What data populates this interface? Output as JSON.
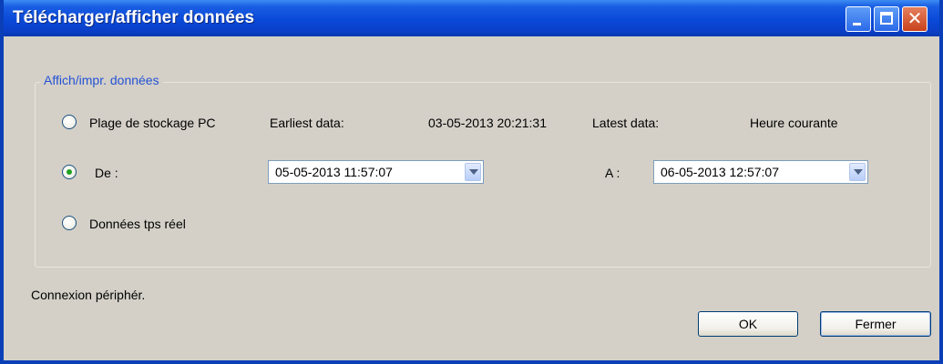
{
  "window": {
    "title": "Télécharger/afficher données"
  },
  "titlebar_buttons": {
    "minimize_icon": "minimize-icon",
    "maximize_icon": "maximize-icon",
    "close_icon": "close-icon",
    "close_glyph": "✕"
  },
  "group": {
    "legend": "Affich/impr. données"
  },
  "options": {
    "storage_range": {
      "label": "Plage de stockage PC",
      "selected": false
    },
    "from": {
      "label": "De :",
      "selected": true
    },
    "realtime": {
      "label": "Données tps réel",
      "selected": false
    }
  },
  "storage_info": {
    "earliest_label": "Earliest data:",
    "earliest_value": "03-05-2013 20:21:31",
    "latest_label": "Latest data:",
    "latest_value": "Heure courante"
  },
  "from_combo": {
    "value": "05-05-2013 11:57:07"
  },
  "to": {
    "label": "A :",
    "value": "06-05-2013 12:57:07"
  },
  "status": {
    "text": "Connexion périphér."
  },
  "buttons": {
    "ok": "OK",
    "close": "Fermer"
  },
  "colors": {
    "titlebar": "#0a49d8",
    "dialog_bg": "#d4d0c8",
    "legend_text": "#2452d4",
    "radio_dot": "#21a121"
  }
}
